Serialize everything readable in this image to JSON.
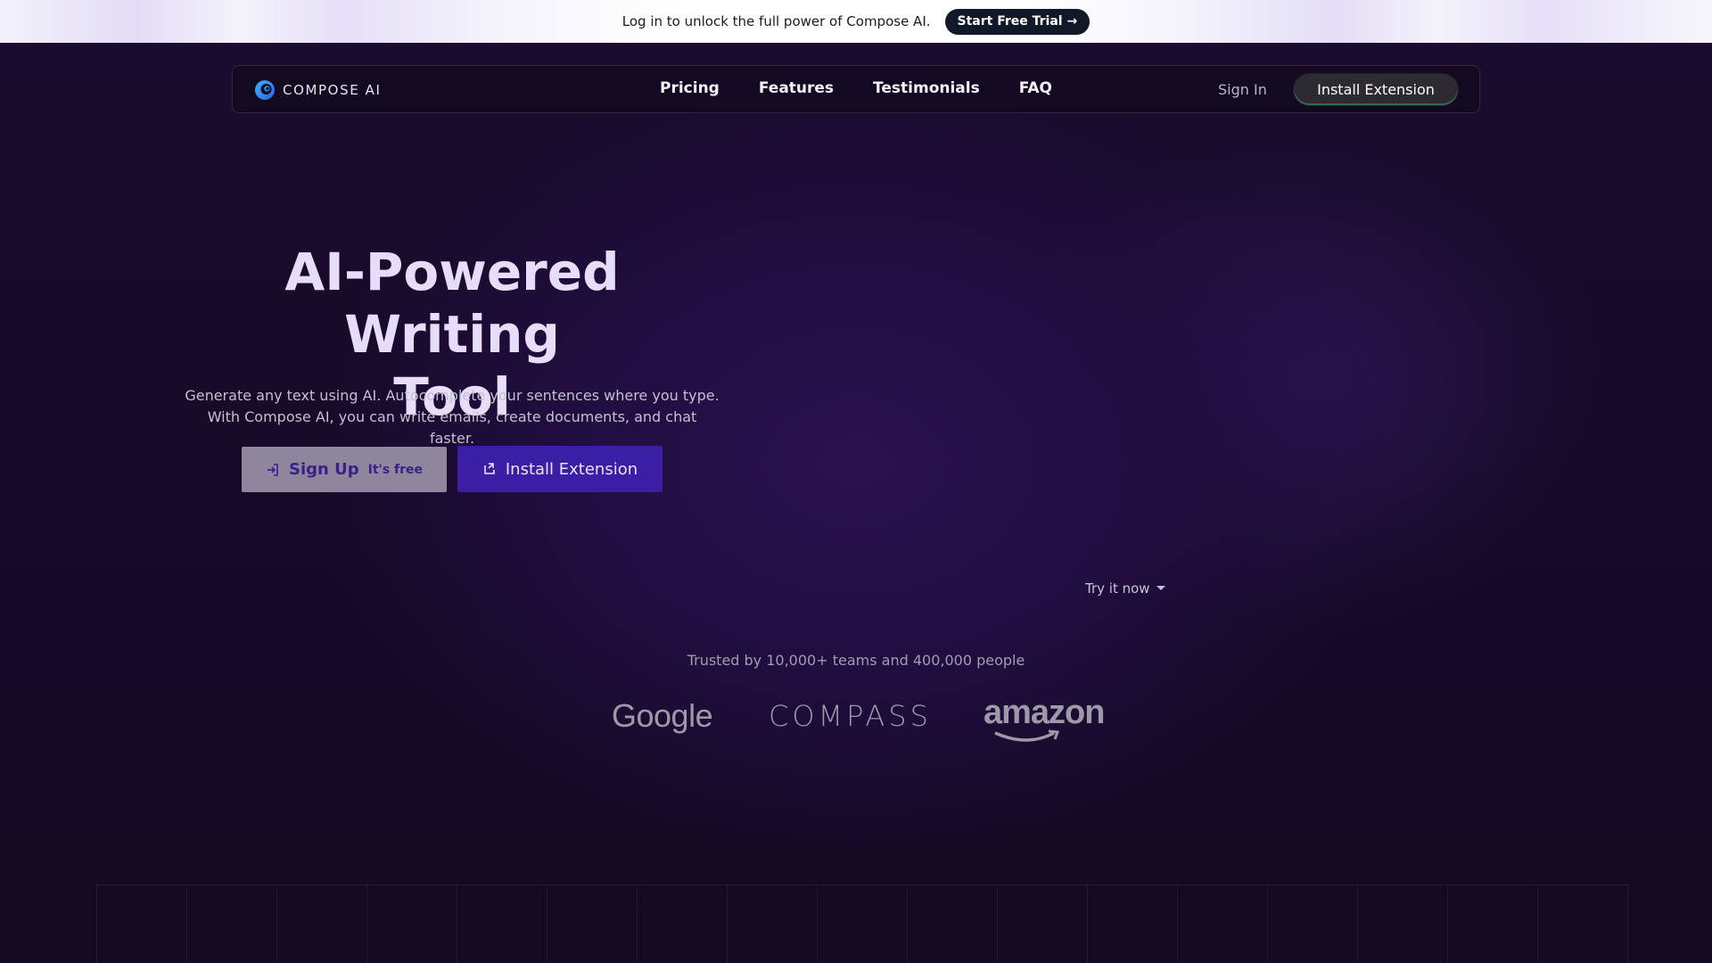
{
  "banner": {
    "text": "Log in to unlock the full power of Compose AI.",
    "cta_label": "Start Free Trial →"
  },
  "nav": {
    "brand": "COMPOSE AI",
    "links": [
      "Pricing",
      "Features",
      "Testimonials",
      "FAQ"
    ],
    "sign_in": "Sign In",
    "install": "Install Extension"
  },
  "hero": {
    "title_line1": "AI-Powered Writing",
    "title_line2": "Tool",
    "subtitle_line1": "Generate any text using AI. Autocomplete your sentences where you type.",
    "subtitle_line2": "With Compose AI, you can write emails, create documents, and chat faster.",
    "signup_label": "Sign Up",
    "signup_badge": "It's free",
    "install_label": "Install Extension",
    "try_label": "Try it now"
  },
  "trusted": {
    "text": "Trusted by 10,000+ teams and 400,000 people",
    "logos": [
      "Google",
      "COMPASS",
      "amazon"
    ]
  },
  "colors": {
    "background": "#120a1f",
    "accent_purple": "#3a1ea3",
    "banner_button": "#111827",
    "title": "#e6ddf8"
  },
  "icons": [
    "compose-logo-icon",
    "sign-in-icon",
    "download-icon",
    "chevron-down-icon"
  ]
}
